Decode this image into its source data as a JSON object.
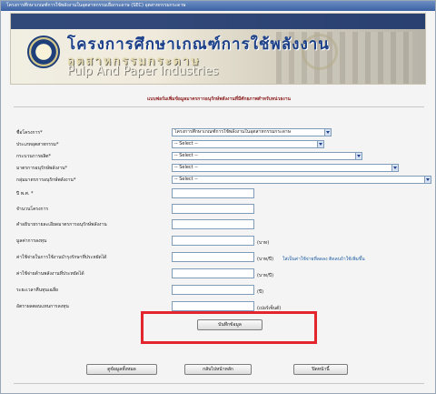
{
  "window": {
    "title": "โครงการศึกษาเกณฑ์การใช้พลังงานในอุตสาหกรรมเยื่อกระดาษ (SEC) อุตสาหกรรมกระดาษ"
  },
  "banner": {
    "thai_title": "โครงการศึกษาเกณฑ์การใช้พลังงาน",
    "thai_sub": "อุตสาหกรรมกระดาษ",
    "english": "Pulp And Paper Industries"
  },
  "form": {
    "heading": "แบบฟอร์มเพิ่มข้อมูลมาตรการอนุรักษ์พลังงานที่มีศักยภาพสำหรับหน่วยงาน",
    "fields": [
      {
        "label": "ชื่อโครงการ*",
        "type": "select",
        "value": "โครงการศึกษาเกณฑ์การใช้พลังงานในอุตสาหกรรมกระดาษ"
      },
      {
        "label": "ประเภทอุตสาหกรรม*",
        "type": "select",
        "value": "-- Select --"
      },
      {
        "label": "กระบวนการผลิต*",
        "type": "select",
        "value": "-- Select --"
      },
      {
        "label": "มาตรการอนุรักษ์พลังงาน*",
        "type": "select",
        "value": "-- Select --"
      },
      {
        "label": "กลุ่มมาตรการอนุรักษ์พลังงาน*",
        "type": "select",
        "value": "-- Select --"
      },
      {
        "label": "ปี พ.ศ. *",
        "type": "input",
        "value": ""
      },
      {
        "label": "จำนวนโครงการ",
        "type": "input",
        "value": ""
      },
      {
        "label": "คำอธิบายรายละเอียดมาตรการอนุรักษ์พลังงาน",
        "type": "input",
        "value": ""
      },
      {
        "label": "มูลค่าการลงทุน",
        "type": "input",
        "value": "",
        "unit": "(บาท)"
      },
      {
        "label": "ค่าใช้จ่ายในการใช้งานบำรุงรักษาที่ประหยัดได้",
        "type": "input",
        "value": "",
        "unit": "(บาท/ปี)",
        "note": "ใส่เป็นค่าใช้จ่ายที่ลดลง ติดลบถ้าใช้เพิ่มขึ้น"
      },
      {
        "label": "ค่าใช้จ่ายด้านพลังงานที่ประหยัดได้",
        "type": "input",
        "value": "",
        "unit": "(บาท/ปี)"
      },
      {
        "label": "ระยะเวลาคืนทุนเฉลี่ย",
        "type": "input",
        "value": "",
        "unit": "(ปี)"
      },
      {
        "label": "อัตราผลตอบแทนการลงทุน",
        "type": "input",
        "value": "",
        "unit": "(เปอร์เซ็นต์)"
      }
    ],
    "save_label": "บันทึกข้อมูล"
  },
  "footer": {
    "view_label": "ดูข้อมูลทั้งหมด",
    "home_label": "กลับไปหน้าหลัก",
    "close_label": "ปิดหน้านี้"
  },
  "colors": {
    "highlight": "#e3262d",
    "heading": "#8a1a1a",
    "note": "#1f5fa3"
  }
}
